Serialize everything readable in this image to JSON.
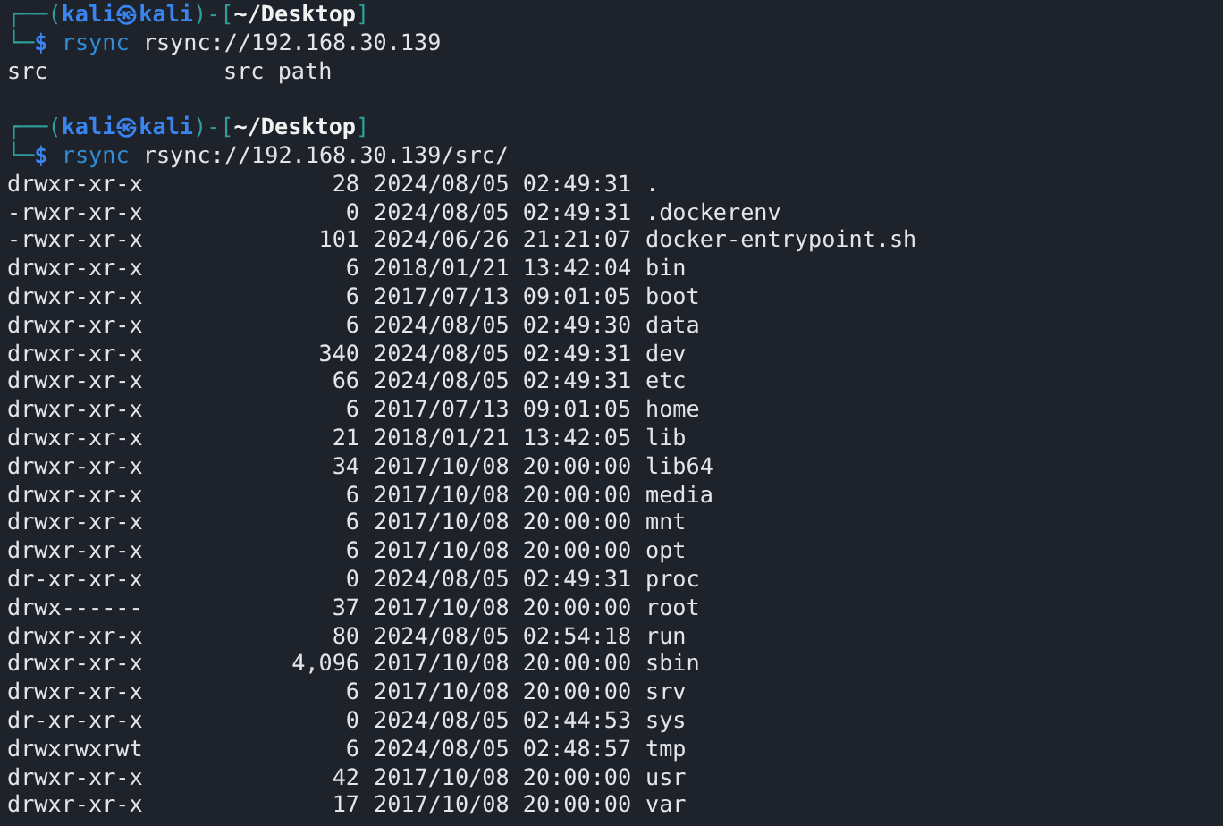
{
  "blocks": [
    {
      "prompt": {
        "open": "┌──(",
        "user": "kali",
        "at": "㉿",
        "host": "kali",
        "sep": ")-[",
        "path": "~/Desktop",
        "close": "]",
        "corner": "└─",
        "symbol": "$"
      },
      "command": "rsync",
      "argument": "rsync://192.168.30.139",
      "modules": [
        {
          "name": "src",
          "comment": "src path"
        }
      ]
    },
    {
      "prompt": {
        "open": "┌──(",
        "user": "kali",
        "at": "㉿",
        "host": "kali",
        "sep": ")-[",
        "path": "~/Desktop",
        "close": "]",
        "corner": "└─",
        "symbol": "$"
      },
      "command": "rsync",
      "argument": "rsync://192.168.30.139/src/",
      "entries": [
        {
          "permissions": "drwxr-xr-x",
          "size": "28",
          "modified": "2024/08/05 02:49:31",
          "name": "."
        },
        {
          "permissions": "-rwxr-xr-x",
          "size": "0",
          "modified": "2024/08/05 02:49:31",
          "name": ".dockerenv"
        },
        {
          "permissions": "-rwxr-xr-x",
          "size": "101",
          "modified": "2024/06/26 21:21:07",
          "name": "docker-entrypoint.sh"
        },
        {
          "permissions": "drwxr-xr-x",
          "size": "6",
          "modified": "2018/01/21 13:42:04",
          "name": "bin"
        },
        {
          "permissions": "drwxr-xr-x",
          "size": "6",
          "modified": "2017/07/13 09:01:05",
          "name": "boot"
        },
        {
          "permissions": "drwxr-xr-x",
          "size": "6",
          "modified": "2024/08/05 02:49:30",
          "name": "data"
        },
        {
          "permissions": "drwxr-xr-x",
          "size": "340",
          "modified": "2024/08/05 02:49:31",
          "name": "dev"
        },
        {
          "permissions": "drwxr-xr-x",
          "size": "66",
          "modified": "2024/08/05 02:49:31",
          "name": "etc"
        },
        {
          "permissions": "drwxr-xr-x",
          "size": "6",
          "modified": "2017/07/13 09:01:05",
          "name": "home"
        },
        {
          "permissions": "drwxr-xr-x",
          "size": "21",
          "modified": "2018/01/21 13:42:05",
          "name": "lib"
        },
        {
          "permissions": "drwxr-xr-x",
          "size": "34",
          "modified": "2017/10/08 20:00:00",
          "name": "lib64"
        },
        {
          "permissions": "drwxr-xr-x",
          "size": "6",
          "modified": "2017/10/08 20:00:00",
          "name": "media"
        },
        {
          "permissions": "drwxr-xr-x",
          "size": "6",
          "modified": "2017/10/08 20:00:00",
          "name": "mnt"
        },
        {
          "permissions": "drwxr-xr-x",
          "size": "6",
          "modified": "2017/10/08 20:00:00",
          "name": "opt"
        },
        {
          "permissions": "dr-xr-xr-x",
          "size": "0",
          "modified": "2024/08/05 02:49:31",
          "name": "proc"
        },
        {
          "permissions": "drwx------",
          "size": "37",
          "modified": "2017/10/08 20:00:00",
          "name": "root"
        },
        {
          "permissions": "drwxr-xr-x",
          "size": "80",
          "modified": "2024/08/05 02:54:18",
          "name": "run"
        },
        {
          "permissions": "drwxr-xr-x",
          "size": "4,096",
          "modified": "2017/10/08 20:00:00",
          "name": "sbin"
        },
        {
          "permissions": "drwxr-xr-x",
          "size": "6",
          "modified": "2017/10/08 20:00:00",
          "name": "srv"
        },
        {
          "permissions": "dr-xr-xr-x",
          "size": "0",
          "modified": "2024/08/05 02:44:53",
          "name": "sys"
        },
        {
          "permissions": "drwxrwxrwt",
          "size": "6",
          "modified": "2024/08/05 02:48:57",
          "name": "tmp"
        },
        {
          "permissions": "drwxr-xr-x",
          "size": "42",
          "modified": "2017/10/08 20:00:00",
          "name": "usr"
        },
        {
          "permissions": "drwxr-xr-x",
          "size": "17",
          "modified": "2017/10/08 20:00:00",
          "name": "var"
        }
      ]
    }
  ]
}
